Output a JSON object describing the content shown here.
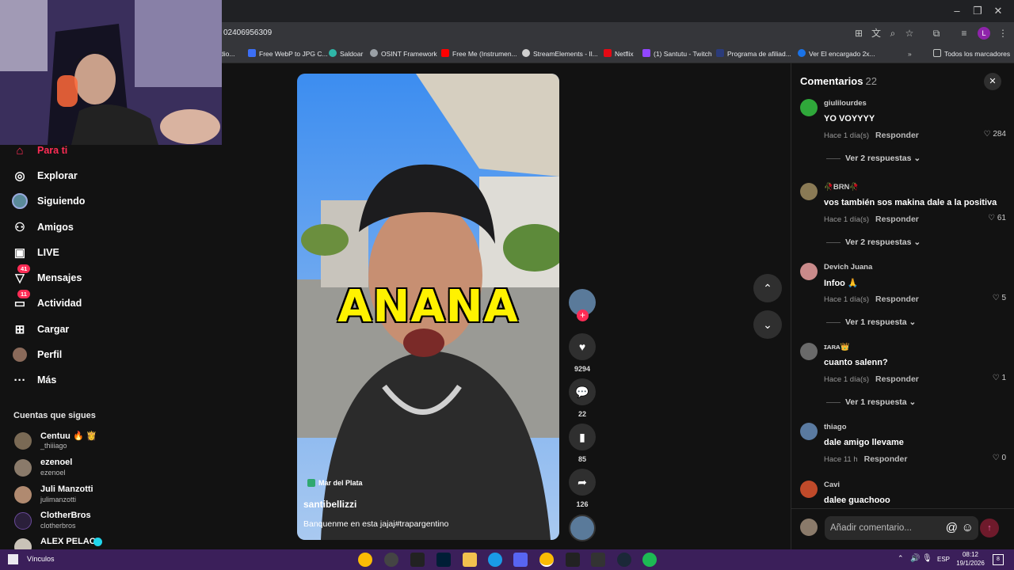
{
  "browser": {
    "url": "02406956309",
    "bookmarks": [
      {
        "label": "dio...",
        "color": "#888888"
      },
      {
        "label": "Free WebP to JPG C...",
        "color": "#3c6ff5"
      },
      {
        "label": "Saldoar",
        "color": "#2fb7a8"
      },
      {
        "label": "OSINT Framework",
        "color": "#9aa0a6"
      },
      {
        "label": "Free Me (Instrumen...",
        "color": "#ff0000"
      },
      {
        "label": "StreamElements - Il...",
        "color": "#cfcfcf"
      },
      {
        "label": "Netflix",
        "color": "#e50914"
      },
      {
        "label": "(1) Santutu - Twitch",
        "color": "#9146ff"
      },
      {
        "label": "Programa de afiliad...",
        "color": "#2b3b7a"
      },
      {
        "label": "Ver El encargado 2x...",
        "color": "#1a73e8"
      }
    ],
    "all_bookmarks": "Todos los marcadores",
    "profile_initial": "L"
  },
  "sidebar": {
    "items": [
      {
        "label": "Para ti",
        "icon": "home-icon"
      },
      {
        "label": "Explorar",
        "icon": "compass-icon"
      },
      {
        "label": "Siguiendo",
        "icon": "following-icon"
      },
      {
        "label": "Amigos",
        "icon": "friends-icon"
      },
      {
        "label": "LIVE",
        "icon": "live-icon"
      },
      {
        "label": "Mensajes",
        "icon": "messages-icon",
        "badge": "41"
      },
      {
        "label": "Actividad",
        "icon": "activity-icon",
        "badge": "11"
      },
      {
        "label": "Cargar",
        "icon": "upload-icon"
      },
      {
        "label": "Perfil",
        "icon": "profile-icon"
      },
      {
        "label": "Más",
        "icon": "more-icon"
      }
    ],
    "following_title": "Cuentas que sigues",
    "following": [
      {
        "name": "Centuu 🔥 👸",
        "handle": "_thiiiago",
        "color": "#7a6a55"
      },
      {
        "name": "ezenoel",
        "handle": "ezenoel",
        "color": "#8a7a6a"
      },
      {
        "name": "Juli Manzotti",
        "handle": "julimanzotti",
        "color": "#b08a70"
      },
      {
        "name": "ClotherBros",
        "handle": "clotherbros",
        "color": "#2a1f3a"
      },
      {
        "name": "ALEX PELAO",
        "handle": "",
        "color": "#c9c2b8"
      }
    ]
  },
  "video": {
    "title_overlay": "ANANA",
    "location": "Mar del Plata",
    "username": "santibellizzi",
    "description": "Banquenme en esta jajaj#trapargentino",
    "likes": "9294",
    "comments": "22",
    "saves": "85",
    "shares": "126"
  },
  "comments_panel": {
    "title": "Comentarios",
    "count": "22",
    "input_placeholder": "Añadir comentario...",
    "items": [
      {
        "user": "giulilourdes",
        "text": "YO VOYYYY",
        "time": "Hace 1 día(s)",
        "reply": "Responder",
        "likes": "284",
        "view": "Ver 2 respuestas",
        "color": "#2fa83a"
      },
      {
        "user": "🥀BRN🥀",
        "text": "vos también sos makina dale a la positiva",
        "time": "Hace 1 día(s)",
        "reply": "Responder",
        "likes": "61",
        "view": "Ver 2 respuestas",
        "color": "#8a7a55"
      },
      {
        "user": "Devich Juana",
        "text": "Infoo 🙏",
        "time": "Hace 1 día(s)",
        "reply": "Responder",
        "likes": "5",
        "view": "Ver 1 respuesta",
        "color": "#c98a8a"
      },
      {
        "user": "ɪᴀʀᴀ👑",
        "text": "cuanto salenn?",
        "time": "Hace 1 día(s)",
        "reply": "Responder",
        "likes": "1",
        "view": "Ver 1 respuesta",
        "color": "#6a6a6a"
      },
      {
        "user": "thiago",
        "text": "dale amigo llevame",
        "time": "Hace 11 h",
        "reply": "Responder",
        "likes": "0",
        "view": "",
        "color": "#5a7aa0"
      },
      {
        "user": "Cavi",
        "text": "dalee guachooo",
        "time": "",
        "reply": "",
        "likes": "",
        "view": "",
        "color": "#c04a2a"
      }
    ]
  },
  "taskbar": {
    "start_label": "Vínculos",
    "lang": "ESP",
    "time": "08:12",
    "date": "19/1/2026",
    "notif_count": "8"
  }
}
